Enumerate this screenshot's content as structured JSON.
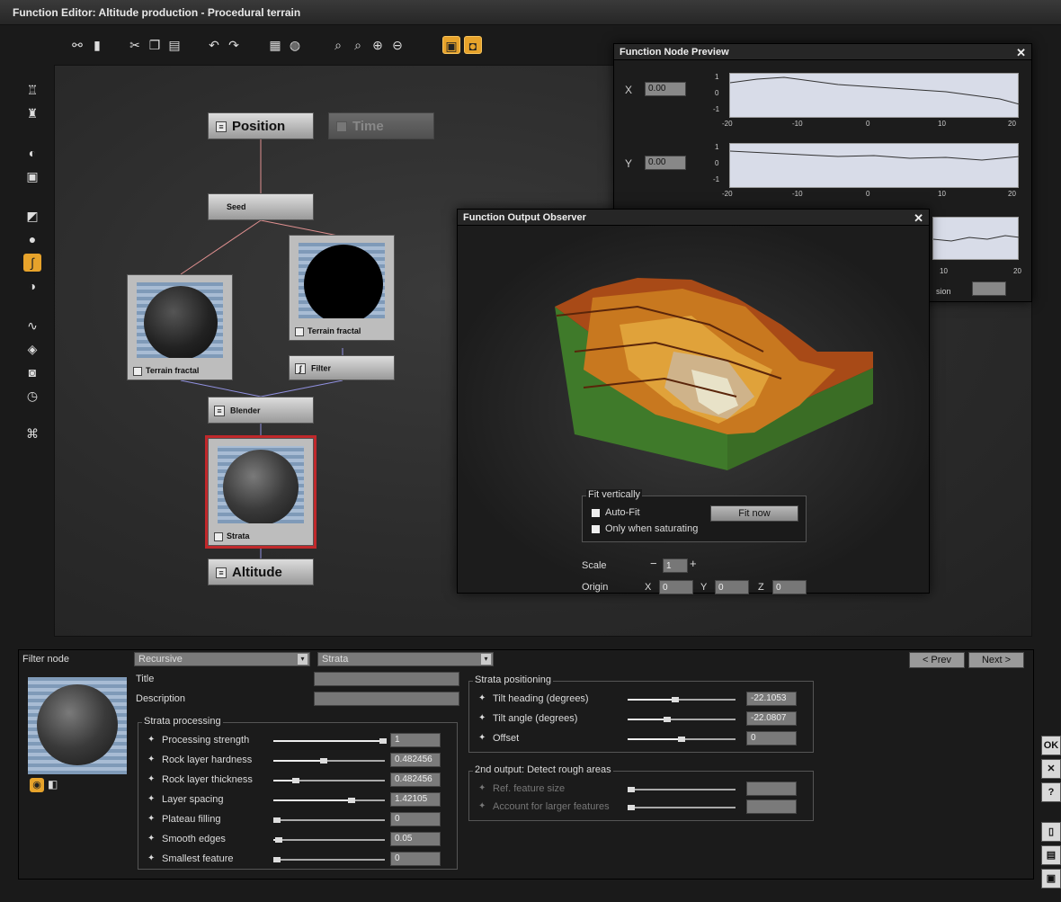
{
  "window": {
    "title": "Function Editor: Altitude production - Procedural terrain"
  },
  "nodes": {
    "position": "Position",
    "time": "Time",
    "seed": "Seed",
    "terrain_fractal_1": "Terrain fractal",
    "terrain_fractal_2": "Terrain fractal",
    "filter": "Filter",
    "blender": "Blender",
    "strata": "Strata",
    "altitude": "Altitude"
  },
  "preview": {
    "title": "Function Node Preview",
    "x_label": "X",
    "x_value": "0.00",
    "y_label": "Y",
    "y_value": "0.00",
    "y_ticks": [
      "1",
      "0",
      "-1"
    ],
    "x_ticks": [
      "-20",
      "-10",
      "0",
      "10",
      "20"
    ],
    "partial_label": "sion"
  },
  "observer": {
    "title": "Function Output Observer",
    "fit_title": "Fit vertically",
    "auto_fit": "Auto-Fit",
    "only_saturating": "Only when saturating",
    "fit_now": "Fit now",
    "scale_label": "Scale",
    "scale_value": "1",
    "origin_label": "Origin",
    "ox_label": "X",
    "ox": "0",
    "oy_label": "Y",
    "oy": "0",
    "oz_label": "Z",
    "oz": "0"
  },
  "bottom": {
    "node_type_label": "Filter node",
    "category": "Recursive",
    "node_name": "Strata",
    "prev": "< Prev",
    "next": "Next >",
    "title_label": "Title",
    "description_label": "Description",
    "strata_processing": {
      "title": "Strata processing",
      "rows": [
        {
          "name": "Processing strength",
          "value": "1",
          "level": 0.98
        },
        {
          "name": "Rock layer hardness",
          "value": "0.482456",
          "level": 0.45
        },
        {
          "name": "Rock layer thickness",
          "value": "0.482456",
          "level": 0.2
        },
        {
          "name": "Layer spacing",
          "value": "1.42105",
          "level": 0.7
        },
        {
          "name": "Plateau filling",
          "value": "0",
          "level": 0.0
        },
        {
          "name": "Smooth edges",
          "value": "0.05",
          "level": 0.05
        },
        {
          "name": "Smallest feature",
          "value": "0",
          "level": 0.0
        }
      ]
    },
    "strata_positioning": {
      "title": "Strata positioning",
      "rows": [
        {
          "name": "Tilt heading (degrees)",
          "value": "-22.1053",
          "level": 0.44
        },
        {
          "name": "Tilt angle (degrees)",
          "value": "-22.0807",
          "level": 0.37
        },
        {
          "name": "Offset",
          "value": "0",
          "level": 0.5
        }
      ]
    },
    "rough_areas": {
      "title": "2nd output: Detect rough areas",
      "rows": [
        {
          "name": "Ref. feature size",
          "value": "",
          "level": 0.0
        },
        {
          "name": "Account for larger features",
          "value": "",
          "level": 0.0
        }
      ]
    }
  },
  "side_buttons": {
    "ok": "OK",
    "close": "✕",
    "help": "?"
  },
  "colors": {
    "accent": "#e7a32b",
    "selection": "#c0282b",
    "terrain_green": "#3f7a2a"
  }
}
